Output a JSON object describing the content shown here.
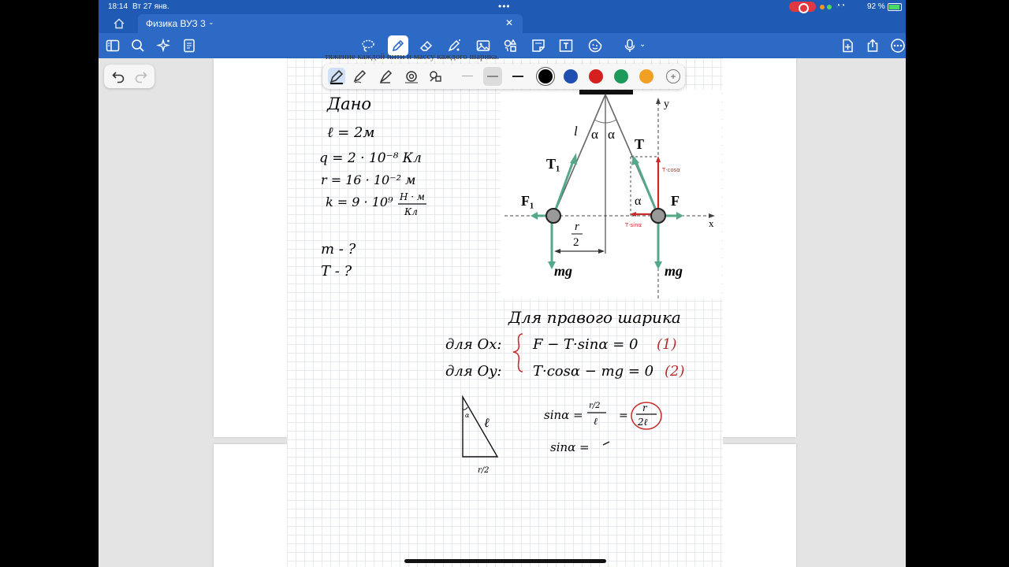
{
  "status": {
    "time": "18:14",
    "date": "Вт 27 янв.",
    "battery": "92 %"
  },
  "tab": {
    "title": "Физика ВУЗ 3"
  },
  "ribbon": {
    "icons": [
      "sidebar-icon",
      "search-icon",
      "sparkle-icon",
      "notes-icon",
      "lasso-icon",
      "pen-icon",
      "eraser-icon",
      "highlighter-icon",
      "image-icon",
      "shapes-icon",
      "note-icon",
      "textbox-icon",
      "sticker-icon",
      "mic-icon",
      "add-page-icon",
      "share-icon",
      "more-icon"
    ]
  },
  "pen_toolbar": {
    "colors": [
      "#000000",
      "#1f4fb0",
      "#d61f1f",
      "#1d9a5a",
      "#f2a024"
    ],
    "selected_color": "#000000"
  },
  "page": {
    "cutoff_text": "тяжение каждой нити и массу каждого шарика.",
    "given": {
      "heading": "Дано",
      "l": "ℓ = 2м",
      "q": "q = 2 · 10⁻⁸ Кл",
      "r": "r = 16 · 10⁻² м",
      "k_left": "k = 9 · 10⁹",
      "k_num": "Н · м",
      "k_den": "Кл",
      "find_m": "m - ?",
      "find_T": "T - ?"
    },
    "diagram": {
      "l": "l",
      "alpha": "α",
      "T": "T",
      "T1": "T₁",
      "F1": "F₁",
      "F": "F",
      "r_num": "r",
      "r_den": "2",
      "mg": "mg",
      "y": "y",
      "x": "x",
      "tcos": "T·cosα",
      "tsin": "T·sinα"
    },
    "solution": {
      "heading": "Для правого шарика",
      "ox_label": "для Ox:",
      "ox_eq": "F − T·sinα = 0",
      "ox_num": "(1)",
      "oy_label": "для Oy:",
      "oy_eq": "T·cosα − mg = 0",
      "oy_num": "(2)",
      "sin_left": "sinα =",
      "sin_frac_top": "r/2",
      "sin_frac_bot": "ℓ",
      "sin_eq": "=",
      "sin_result_top": "r",
      "sin_result_bot": "2ℓ",
      "sin2": "sinα =",
      "tri_l": "ℓ",
      "tri_base": "r/2",
      "tri_angle": "α"
    }
  }
}
